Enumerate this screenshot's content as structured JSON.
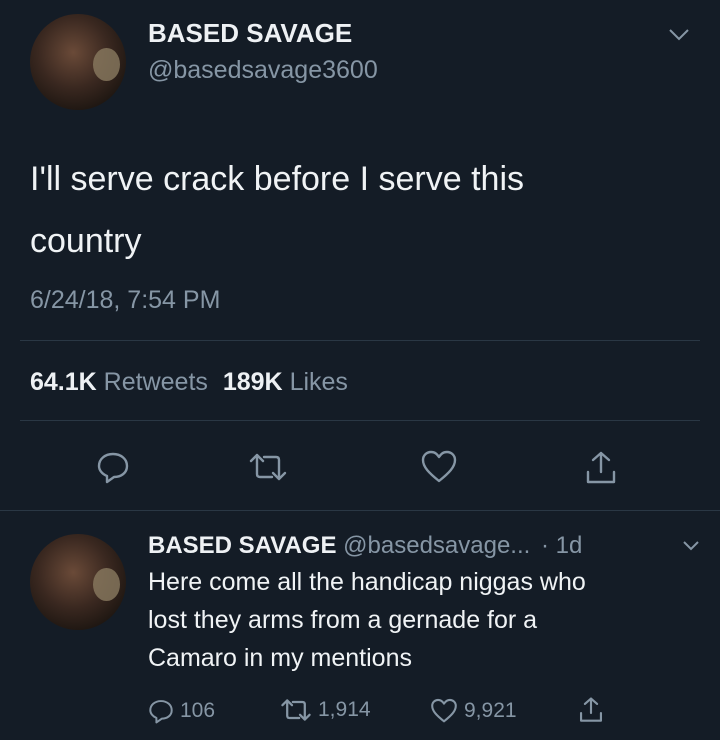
{
  "main_tweet": {
    "display_name": "BASED SAVAGE",
    "handle": "@basedsavage3600",
    "text_line1": "I'll serve crack before I serve this",
    "text_line2": "country",
    "timestamp": "6/24/18, 7:54 PM",
    "retweets_count": "64.1K",
    "retweets_label": "Retweets",
    "likes_count": "189K",
    "likes_label": "Likes"
  },
  "reply": {
    "display_name": "BASED SAVAGE",
    "handle": "@basedsavage...",
    "age": "· 1d",
    "text_line1": "Here come all the handicap niggas who",
    "text_line2": "lost they arms from a gernade for a",
    "text_line3": "Camaro in my mentions",
    "reply_count": "106",
    "retweet_count": "1,914",
    "like_count": "9,921"
  },
  "colors": {
    "background": "#141c26",
    "text": "#e8ecef",
    "muted": "#8696a5"
  },
  "icons": [
    "reply-icon",
    "retweet-icon",
    "like-icon",
    "share-icon",
    "chevron-down-icon"
  ]
}
